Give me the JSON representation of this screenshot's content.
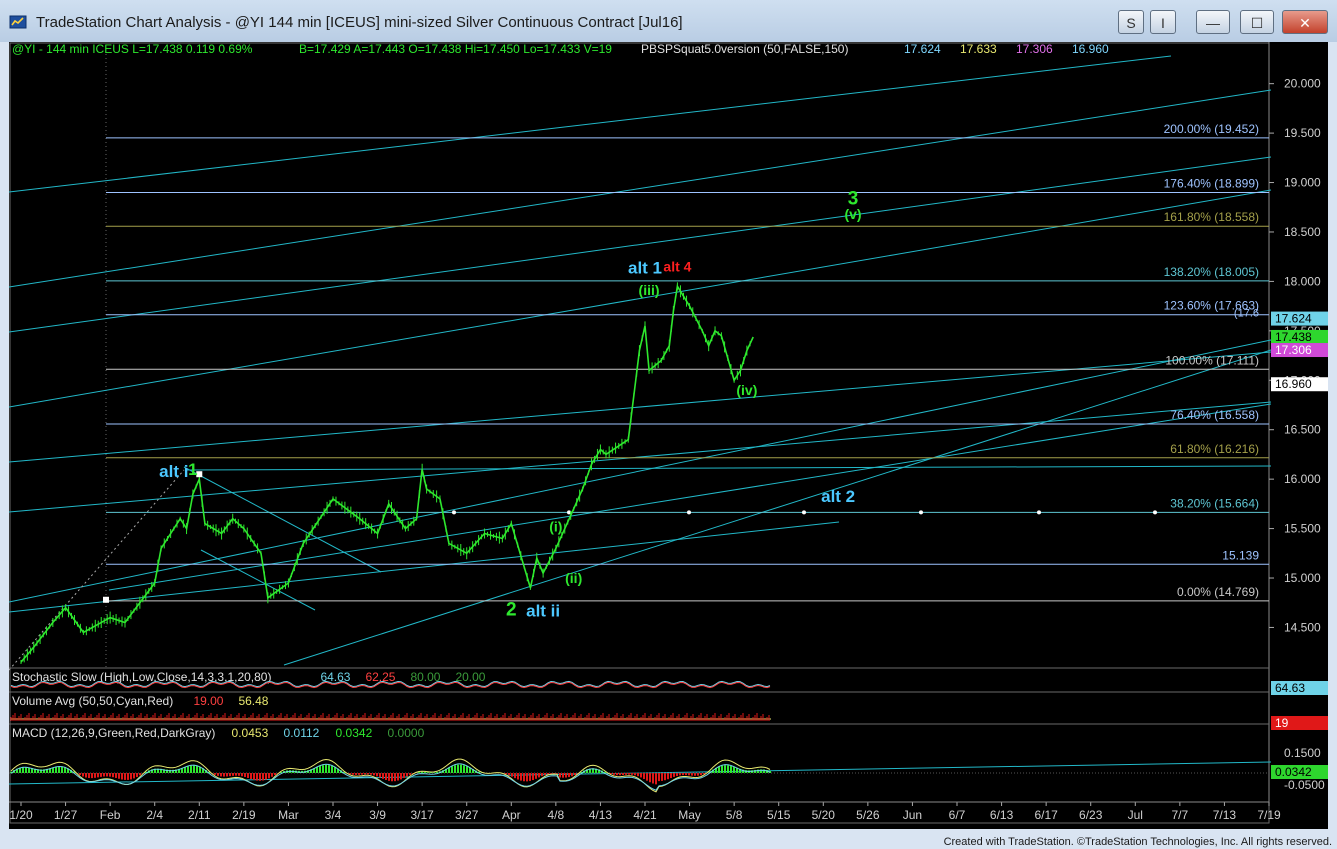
{
  "window": {
    "title": "TradeStation Chart Analysis - @YI 144 min [ICEUS] mini-sized Silver Continuous Contract [Jul16]",
    "btn_s": "S",
    "btn_i": "I",
    "btn_min": "—",
    "btn_max": "☐",
    "btn_close": "✕"
  },
  "header": {
    "symbol_line": "@YI - 144 min  ICEUS  L=17.438  0.119   0.69%",
    "ohlc": "B=17.429  A=17.443  O=17.438  Hi=17.450  Lo=17.433  V=19",
    "indicator": "PBSPSquat5.0version (50,FALSE,150)",
    "ind_values": [
      "17.624",
      "17.633",
      "17.306",
      "16.960"
    ],
    "ind_colors": [
      "#80d8ff",
      "#e8e870",
      "#e070e8",
      "#80d8ff"
    ]
  },
  "footer": {
    "text": "Created with TradeStation. ©TradeStation Technologies, Inc. All rights reserved."
  },
  "chart_data": [
    {
      "type": "line",
      "panel": "price",
      "instrument": "@YI 144 min mini-sized Silver Continuous Contract",
      "price_axis": {
        "ylim": [
          14.1,
          20.3
        ],
        "ticks": [
          "20.000",
          "19.500",
          "19.000",
          "18.500",
          "18.000",
          "17.500",
          "17.000",
          "16.500",
          "16.000",
          "15.500",
          "15.000",
          "14.500"
        ]
      },
      "x_labels": [
        "1/20",
        "1/27",
        "Feb",
        "2/4",
        "2/11",
        "2/19",
        "Mar",
        "3/4",
        "3/9",
        "3/17",
        "3/27",
        "Apr",
        "4/8",
        "4/13",
        "4/21",
        "May",
        "5/8",
        "5/15",
        "5/20",
        "5/26",
        "Jun",
        "6/7",
        "6/13",
        "6/17",
        "6/23",
        "Jul",
        "7/7",
        "7/13",
        "7/19"
      ],
      "price_series": {
        "name": "@YI",
        "color": "#2ee82e",
        "points": [
          [
            "1/20",
            14.15
          ],
          [
            "1/22",
            14.3
          ],
          [
            "1/25",
            14.55
          ],
          [
            "1/27",
            14.7
          ],
          [
            "1/29",
            14.45
          ],
          [
            "Feb",
            14.6
          ],
          [
            "2/2",
            14.55
          ],
          [
            "2/4",
            14.95
          ],
          [
            "2/5",
            15.3
          ],
          [
            "2/8",
            15.6
          ],
          [
            "2/9",
            15.5
          ],
          [
            "2/10",
            15.85
          ],
          [
            "2/11",
            16.0
          ],
          [
            "2/12",
            15.55
          ],
          [
            "2/15",
            15.45
          ],
          [
            "2/17",
            15.6
          ],
          [
            "2/19",
            15.5
          ],
          [
            "2/22",
            15.35
          ],
          [
            "2/24",
            15.25
          ],
          [
            "2/26",
            14.8
          ],
          [
            "Mar",
            14.95
          ],
          [
            "3/2",
            15.35
          ],
          [
            "3/4",
            15.8
          ],
          [
            "3/7",
            15.6
          ],
          [
            "3/9",
            15.45
          ],
          [
            "3/11",
            15.75
          ],
          [
            "3/14",
            15.5
          ],
          [
            "3/16",
            15.6
          ],
          [
            "3/17",
            16.1
          ],
          [
            "3/18",
            15.9
          ],
          [
            "3/21",
            15.8
          ],
          [
            "3/23",
            15.35
          ],
          [
            "3/27",
            15.25
          ],
          [
            "3/29",
            15.45
          ],
          [
            "3/31",
            15.4
          ],
          [
            "Apr",
            15.55
          ],
          [
            "4/4",
            14.9
          ],
          [
            "4/5",
            15.2
          ],
          [
            "4/6",
            15.05
          ],
          [
            "4/8",
            15.3
          ],
          [
            "4/11",
            15.9
          ],
          [
            "4/12",
            16.15
          ],
          [
            "4/13",
            16.3
          ],
          [
            "4/14",
            16.25
          ],
          [
            "4/18",
            16.4
          ],
          [
            "4/19",
            16.85
          ],
          [
            "4/20",
            17.3
          ],
          [
            "4/21",
            17.55
          ],
          [
            "4/22",
            17.1
          ],
          [
            "4/25",
            17.2
          ],
          [
            "4/27",
            17.35
          ],
          [
            "4/28",
            17.7
          ],
          [
            "4/29",
            17.95
          ],
          [
            "May",
            17.75
          ],
          [
            "5/3",
            17.5
          ],
          [
            "5/4",
            17.35
          ],
          [
            "5/5",
            17.5
          ],
          [
            "5/6",
            17.45
          ],
          [
            "5/8",
            17.0
          ],
          [
            "5/9",
            17.1
          ],
          [
            "5/10",
            17.3
          ],
          [
            "5/11",
            17.438
          ]
        ]
      },
      "fib_levels": [
        {
          "label": "200.00% (19.452)",
          "value": 19.452,
          "color": "#9ec3ff"
        },
        {
          "label": "176.40% (18.899)",
          "value": 18.899,
          "color": "#9ec3ff"
        },
        {
          "label": "161.80% (18.558)",
          "value": 18.558,
          "color": "#a4a04a"
        },
        {
          "label": "138.20% (18.005)",
          "value": 18.005,
          "color": "#5ec6d3"
        },
        {
          "label": "123.60% (17.663)",
          "value": 17.663,
          "color": "#9ec3ff"
        },
        {
          "label": "100.00% (17.111)",
          "value": 17.111,
          "color": "#c8c8c8"
        },
        {
          "label": "76.40% (16.558)",
          "value": 16.558,
          "color": "#9ec3ff"
        },
        {
          "label": "61.80% (16.216)",
          "value": 16.216,
          "color": "#a4a04a"
        },
        {
          "label": "38.20% (15.664)",
          "value": 15.664,
          "color": "#5ec6d3"
        },
        {
          "label": "15.139",
          "value": 15.139,
          "color": "#9ec3ff"
        },
        {
          "label": "0.00% (14.769)",
          "value": 14.769,
          "color": "#c8c8c8"
        }
      ],
      "fib_ghost_label": "(17.6",
      "value_badges": [
        {
          "value": 17.624,
          "label": "17.624",
          "bg": "#6fd3e8",
          "fg": "#000000"
        },
        {
          "value": 17.438,
          "label": "17.438",
          "bg": "#2ed62e",
          "fg": "#000000"
        },
        {
          "value": 17.306,
          "label": "17.306",
          "bg": "#d04ad8",
          "fg": "#ffffff"
        },
        {
          "value": 16.96,
          "label": "16.960",
          "bg": "#ffffff",
          "fg": "#000000"
        }
      ],
      "wave_labels": [
        {
          "text": "alt i",
          "x": "2/7",
          "y": 16.02,
          "color": "#4cc8ff",
          "size": 17
        },
        {
          "text": "1",
          "x": "2/10",
          "y": 16.04,
          "color": "#2ee82e",
          "size": 17
        },
        {
          "text": "2",
          "x": "4/1",
          "y": 14.62,
          "color": "#2ee82e",
          "size": 19
        },
        {
          "text": "alt ii",
          "x": "4/6",
          "y": 14.61,
          "color": "#4cc8ff",
          "size": 17
        },
        {
          "text": "(i)",
          "x": "4/8",
          "y": 15.47,
          "color": "#2ee82e",
          "size": 14
        },
        {
          "text": "(ii)",
          "x": "4/10",
          "y": 14.95,
          "color": "#2ee82e",
          "size": 14
        },
        {
          "text": "(iii)",
          "x": "4/22",
          "y": 17.86,
          "color": "#2ee82e",
          "size": 14
        },
        {
          "text": "alt 1",
          "x": "4/21",
          "y": 18.08,
          "color": "#4cc8ff",
          "size": 17
        },
        {
          "text": "alt 4",
          "x": "4/29",
          "y": 18.1,
          "color": "#ff2020",
          "size": 14
        },
        {
          "text": "(iv)",
          "x": "5/10",
          "y": 16.85,
          "color": "#2ee82e",
          "size": 14
        },
        {
          "text": "3",
          "x": "5/24",
          "y": 18.78,
          "color": "#2ee82e",
          "size": 19
        },
        {
          "text": "(v)",
          "x": "5/24",
          "y": 18.63,
          "color": "#2ee82e",
          "size": 14
        },
        {
          "text": "alt 2",
          "x": "5/22",
          "y": 15.77,
          "color": "#4cc8ff",
          "size": 17
        }
      ]
    },
    {
      "type": "line",
      "panel": "stochastic",
      "label": "Stochastic Slow (High,Low,Close,14,3,3,1,20,80)",
      "values": [
        "64.63",
        "62.25",
        "80.00",
        "20.00"
      ],
      "value_colors": [
        "#6fd3e8",
        "#ff4040",
        "#3a9a3a",
        "#3a9a3a"
      ],
      "badge": "64.63"
    },
    {
      "type": "bar",
      "panel": "volume",
      "label": "Volume Avg (50,50,Cyan,Red)",
      "values": [
        "19.00",
        "56.48"
      ],
      "value_colors": [
        "#ff4040",
        "#e8e870"
      ],
      "badge": "19"
    },
    {
      "type": "bar",
      "panel": "macd",
      "label": "MACD (12,26,9,Green,Red,DarkGray)",
      "values": [
        "0.0453",
        "0.0112",
        "0.0342",
        "0.0000"
      ],
      "value_colors": [
        "#e8e870",
        "#6fd3e8",
        "#2ee82e",
        "#3a9a3a"
      ],
      "ticks": [
        "0.1500",
        "0.0342",
        "-0.0500"
      ],
      "badge": "0.0342"
    }
  ]
}
